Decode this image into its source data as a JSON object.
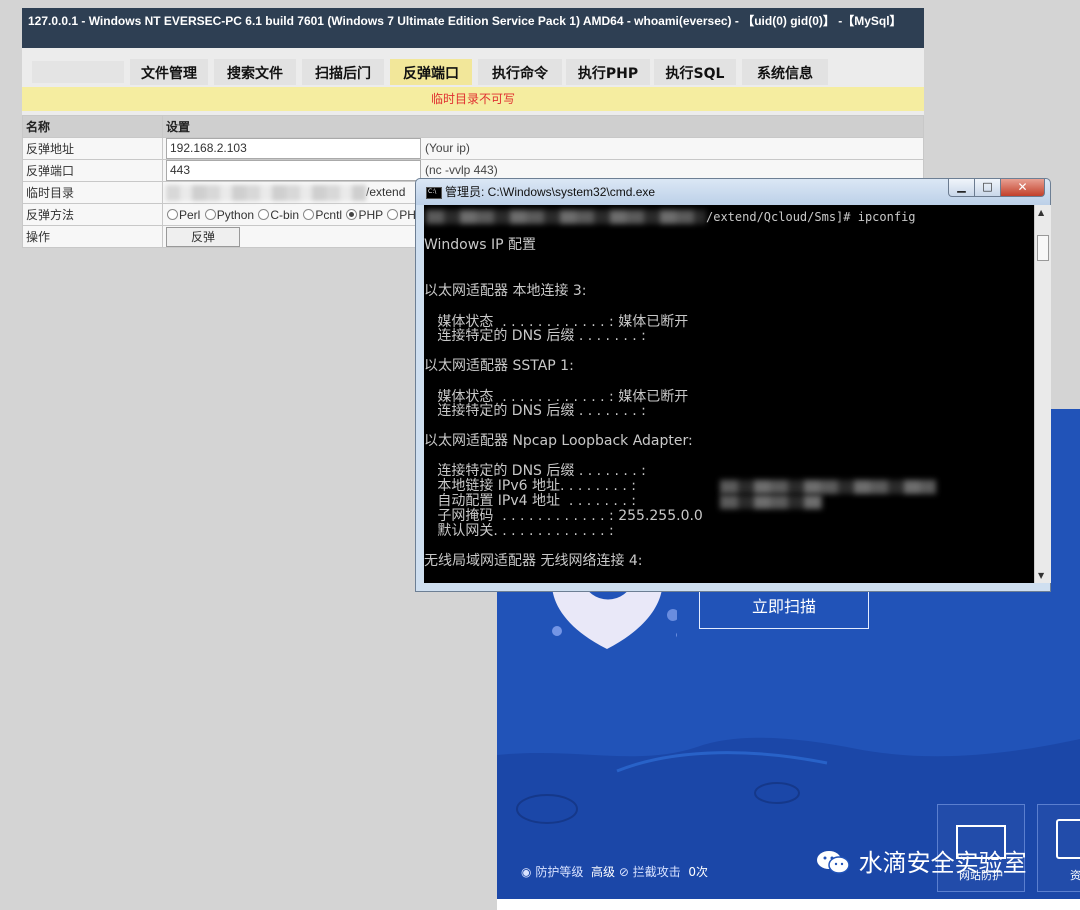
{
  "shell": {
    "title": "127.0.0.1 - Windows NT EVERSEC-PC 6.1 build 7601 (Windows 7 Ultimate Edition Service Pack 1) AMD64 - whoami(eversec) - 【uid(0) gid(0)】 -【MySql】",
    "tabs": [
      "文件管理",
      "搜索文件",
      "扫描后门",
      "反弹端口",
      "执行命令",
      "执行PHP",
      "执行SQL",
      "系统信息"
    ],
    "active_tab": "反弹端口",
    "notice": "临时目录不可写",
    "table": {
      "col_name": "名称",
      "col_setting": "设置",
      "rows": {
        "addr_label": "反弹地址",
        "addr_value": "192.168.2.103",
        "addr_hint": "(Your ip)",
        "port_label": "反弹端口",
        "port_value": "443",
        "port_hint": "(nc -vvlp 443)",
        "tmp_label": "临时目录",
        "tmp_suffix": "/extend",
        "method_label": "反弹方法",
        "methods": [
          "Perl",
          "Python",
          "C-bin",
          "Pcntl",
          "PHP",
          "PH"
        ],
        "selected_method": "PHP",
        "op_label": "操作",
        "op_button": "反弹"
      }
    }
  },
  "cmd": {
    "title": "管理员: C:\\Windows\\system32\\cmd.exe",
    "prompt_suffix": "/extend/Qcloud/Sms]# ipconfig",
    "lines": {
      "l1": "Windows IP 配置",
      "l2": "以太网适配器 本地连接 3:",
      "l3": "   媒体状态  . . . . . . . . . . . . : 媒体已断开",
      "l4": "   连接特定的 DNS 后缀 . . . . . . . :",
      "l5": "以太网适配器 SSTAP 1:",
      "l6": "   媒体状态  . . . . . . . . . . . . : 媒体已断开",
      "l7": "   连接特定的 DNS 后缀 . . . . . . . :",
      "l8": "以太网适配器 Npcap Loopback Adapter:",
      "l9": "   连接特定的 DNS 后缀 . . . . . . . :",
      "l10": "   本地链接 IPv6 地址. . . . . . . . :",
      "l11": "   自动配置 IPv4 地址  . . . . . . . :",
      "l12": "   子网掩码  . . . . . . . . . . . . : 255.255.0.0",
      "l13": "   默认网关. . . . . . . . . . . . . :",
      "l14": "无线局域网适配器 无线网络连接 4:"
    }
  },
  "app": {
    "scan_button": "立即扫描",
    "status_protect": "防护等级",
    "status_level": "高级",
    "status_block": "拦截攻击",
    "status_count": "0次",
    "side_btn_1": "网站防护",
    "side_btn_2": "资源",
    "watermark": "水滴安全实验室",
    "colors": {
      "bg": "#2153b8",
      "moon": "#1b47a8"
    }
  }
}
